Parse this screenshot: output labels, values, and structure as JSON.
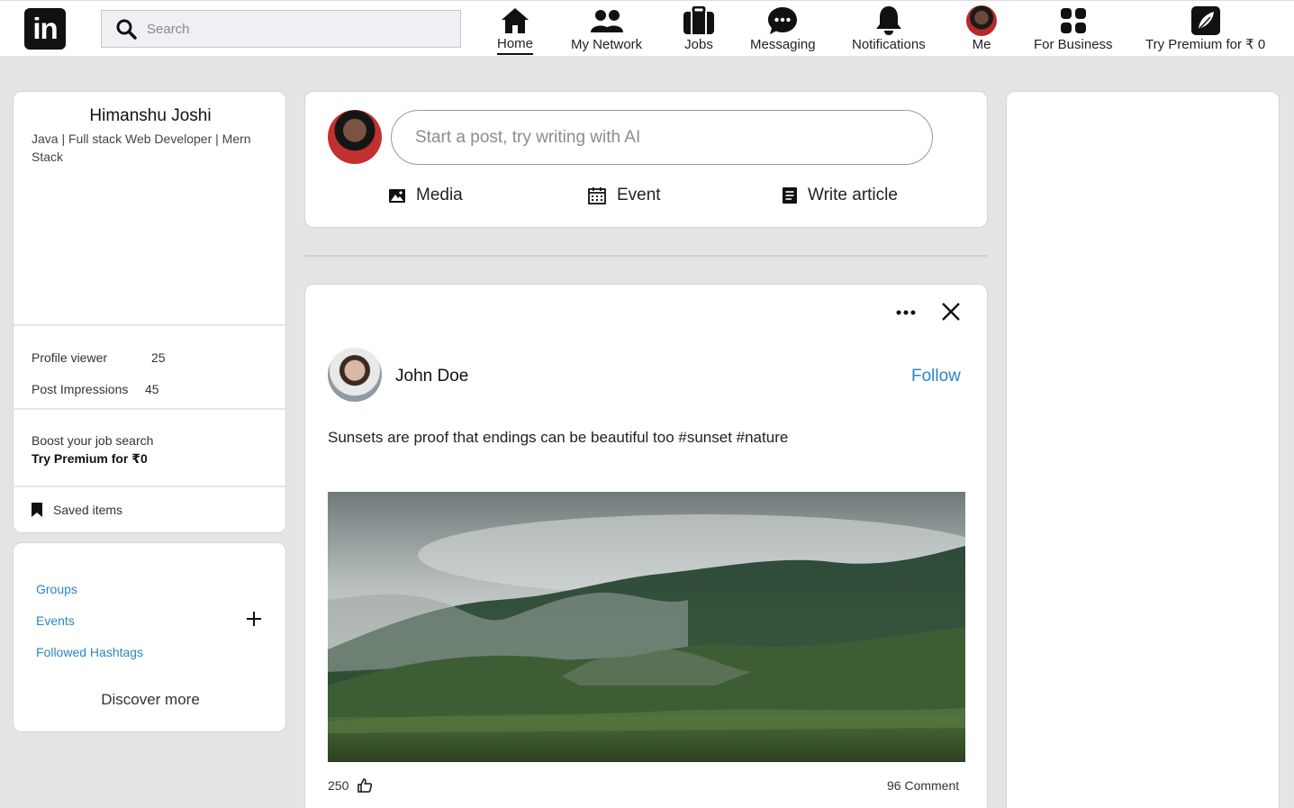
{
  "navbar": {
    "logo_text": "in",
    "search_placeholder": "Search",
    "items": [
      {
        "label": "Home",
        "icon": "home-icon"
      },
      {
        "label": "My Network",
        "icon": "network-icon"
      },
      {
        "label": "Jobs",
        "icon": "briefcase-icon"
      },
      {
        "label": "Messaging",
        "icon": "messaging-icon"
      },
      {
        "label": "Notifications",
        "icon": "bell-icon"
      },
      {
        "label": "Me",
        "icon": "avatar"
      },
      {
        "label": "For Business",
        "icon": "grid-icon"
      },
      {
        "label": "Try Premium for ₹ 0",
        "icon": "premium-icon"
      }
    ]
  },
  "profile": {
    "name": "Himanshu Joshi",
    "headline": "Java | Full stack Web Developer | Mern Stack",
    "stats": [
      {
        "label": "Profile viewer",
        "value": "25"
      },
      {
        "label": "Post Impressions",
        "value": "45"
      }
    ],
    "boost_text": "Boost your job search",
    "boost_link": "Try Premium for ₹0",
    "saved_items": "Saved items"
  },
  "links": {
    "groups": "Groups",
    "events": "Events",
    "hashtags": "Followed Hashtags",
    "discover": "Discover more"
  },
  "composer": {
    "placeholder": "Start a post, try writing with AI",
    "actions": [
      {
        "label": "Media",
        "icon": "image-icon"
      },
      {
        "label": "Event",
        "icon": "calendar-icon"
      },
      {
        "label": "Write article",
        "icon": "article-icon"
      }
    ]
  },
  "post": {
    "author": "John Doe",
    "follow_label": "Follow",
    "text": "Sunsets are proof that endings can be beautiful too #sunset #nature",
    "likes": "250",
    "comments": "96 Comment"
  },
  "colors": {
    "accent": "#2b86c5",
    "background": "#e4e4e7"
  }
}
